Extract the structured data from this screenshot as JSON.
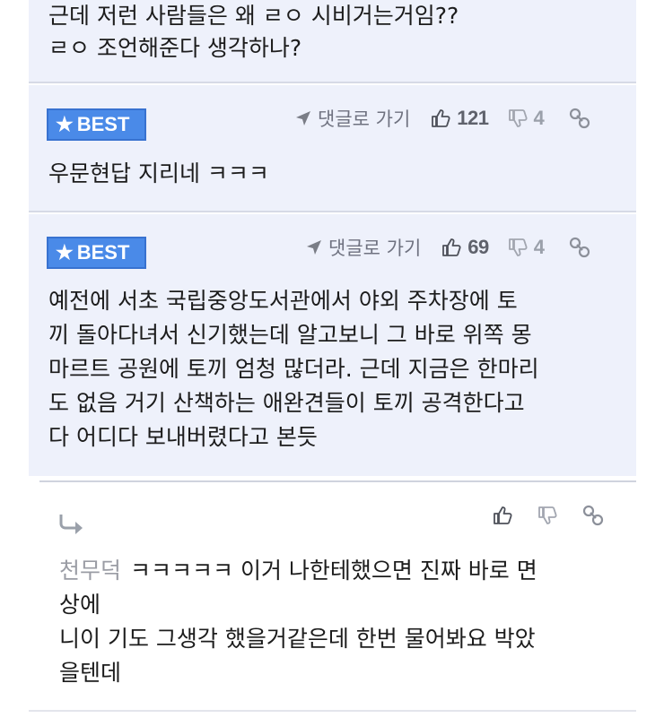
{
  "top_comment": {
    "lines": [
      "근데 저런 사람들은 왜 ㄹㅇ 시비거는거임??",
      "ㄹㅇ 조언해준다 생각하나?"
    ]
  },
  "comments": [
    {
      "badge": "BEST",
      "reply_label": "댓글로 가기",
      "likes": "121",
      "dislikes": "4",
      "lines": [
        "우문현답 지리네 ㅋㅋㅋ"
      ]
    },
    {
      "badge": "BEST",
      "reply_label": "댓글로 가기",
      "likes": "69",
      "dislikes": "4",
      "lines": [
        "예전에 서초 국립중앙도서관에서 야외 주차장에 토",
        "끼 돌아다녀서 신기했는데 알고보니 그 바로 위쪽 몽",
        "마르트 공원에 토끼 엄청 많더라. 근데 지금은 한마리",
        "도 없음 거기 산책하는 애완견들이 토끼 공격한다고",
        "다 어디다 보내버렸다고 본듯"
      ]
    }
  ],
  "reply": {
    "author": "천무덕",
    "lines": [
      "ㅋㅋㅋㅋㅋ 이거 나한테했으면 진짜 바로 면",
      "상에",
      "니이 기도 그생각 했을거같은데 한번 물어봐요 박았",
      "을텐데"
    ]
  },
  "icons": {
    "reply_arrow": "reply-arrow-icon",
    "thumbs_up": "thumbs-up-icon",
    "thumbs_down": "thumbs-down-icon",
    "link": "link-icon",
    "send": "send-arrow-icon",
    "star": "star-icon"
  },
  "colors": {
    "badge_bg": "#4a8ae8",
    "panel_bg": "#eef1fb",
    "text": "#1c1c1c",
    "muted": "#7a7d86"
  }
}
